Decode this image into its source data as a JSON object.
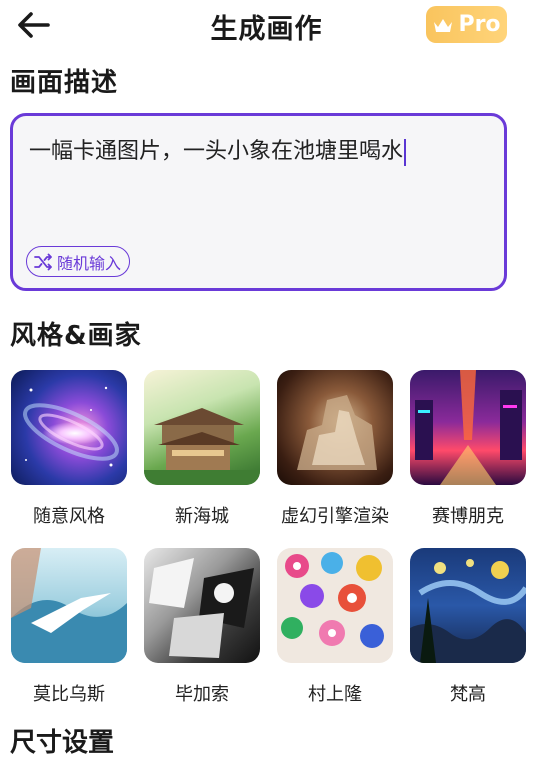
{
  "header": {
    "title": "生成画作",
    "pro_label": "Pro"
  },
  "description_section": {
    "title": "画面描述",
    "text": "一幅卡通图片，一头小象在池塘里喝水",
    "random_label": "随机输入"
  },
  "style_section": {
    "title": "风格&画家",
    "items": [
      {
        "label": "随意风格"
      },
      {
        "label": "新海城"
      },
      {
        "label": "虚幻引擎渲染"
      },
      {
        "label": "赛博朋克"
      },
      {
        "label": "莫比乌斯"
      },
      {
        "label": "毕加索"
      },
      {
        "label": "村上隆"
      },
      {
        "label": "梵高"
      }
    ]
  },
  "size_section": {
    "title": "尺寸设置"
  },
  "colors": {
    "accent": "#6a3ad8",
    "pro_gold": "#f9c45d"
  }
}
